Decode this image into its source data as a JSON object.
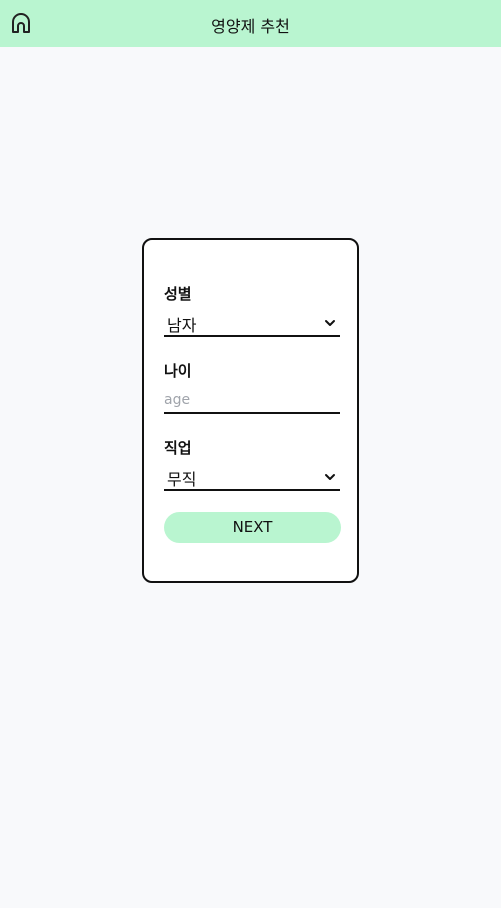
{
  "header": {
    "title": "영양제 추천",
    "home_icon": "home-icon"
  },
  "form": {
    "gender": {
      "label": "성별",
      "selected": "남자"
    },
    "age": {
      "label": "나이",
      "value": "",
      "placeholder": "age"
    },
    "job": {
      "label": "직업",
      "selected": "무직"
    },
    "next_label": "NEXT"
  },
  "colors": {
    "accent": "#b9f5d0",
    "background": "#f8f9fb",
    "card_border": "#111111"
  }
}
